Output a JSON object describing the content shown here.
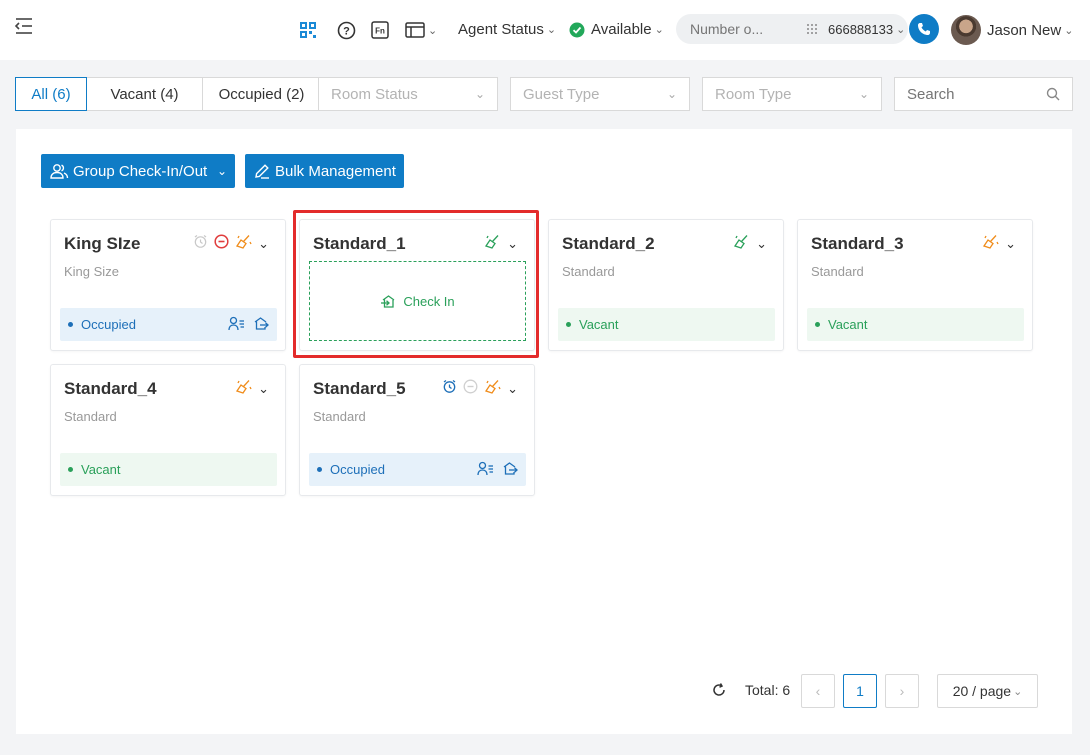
{
  "topbar": {
    "menu_icon": "menu-fold-icon",
    "agent_status_label": "Agent Status",
    "availability": "Available",
    "number_placeholder": "Number o...",
    "line_number": "666888133",
    "user_name": "Jason New"
  },
  "filters": {
    "tabs": [
      {
        "label": "All (6)"
      },
      {
        "label": "Vacant (4)"
      },
      {
        "label": "Occupied (2)"
      }
    ],
    "room_status_placeholder": "Room Status",
    "guest_type_placeholder": "Guest Type",
    "room_type_placeholder": "Room Type",
    "search_placeholder": "Search"
  },
  "actions": {
    "group_checkin": "Group Check-In/Out",
    "bulk_management": "Bulk Management"
  },
  "rooms": [
    {
      "name": "King SIze",
      "type": "King Size",
      "status": "Occupied"
    },
    {
      "name": "Standard_1",
      "type": "",
      "status": "",
      "action": "Check In"
    },
    {
      "name": "Standard_2",
      "type": "Standard",
      "status": "Vacant"
    },
    {
      "name": "Standard_3",
      "type": "Standard",
      "status": "Vacant"
    },
    {
      "name": "Standard_4",
      "type": "Standard",
      "status": "Vacant"
    },
    {
      "name": "Standard_5",
      "type": "Standard",
      "status": "Occupied"
    }
  ],
  "pagination": {
    "total_label": "Total: 6",
    "current_page": "1",
    "page_size": "20 / page"
  },
  "colors": {
    "accent": "#0f7cc6",
    "vacant": "#2aa05a",
    "occupied": "#1d6fb8",
    "highlight": "#e32b2b",
    "dirty": "#f08c1a",
    "alert": "#e03c3c"
  }
}
